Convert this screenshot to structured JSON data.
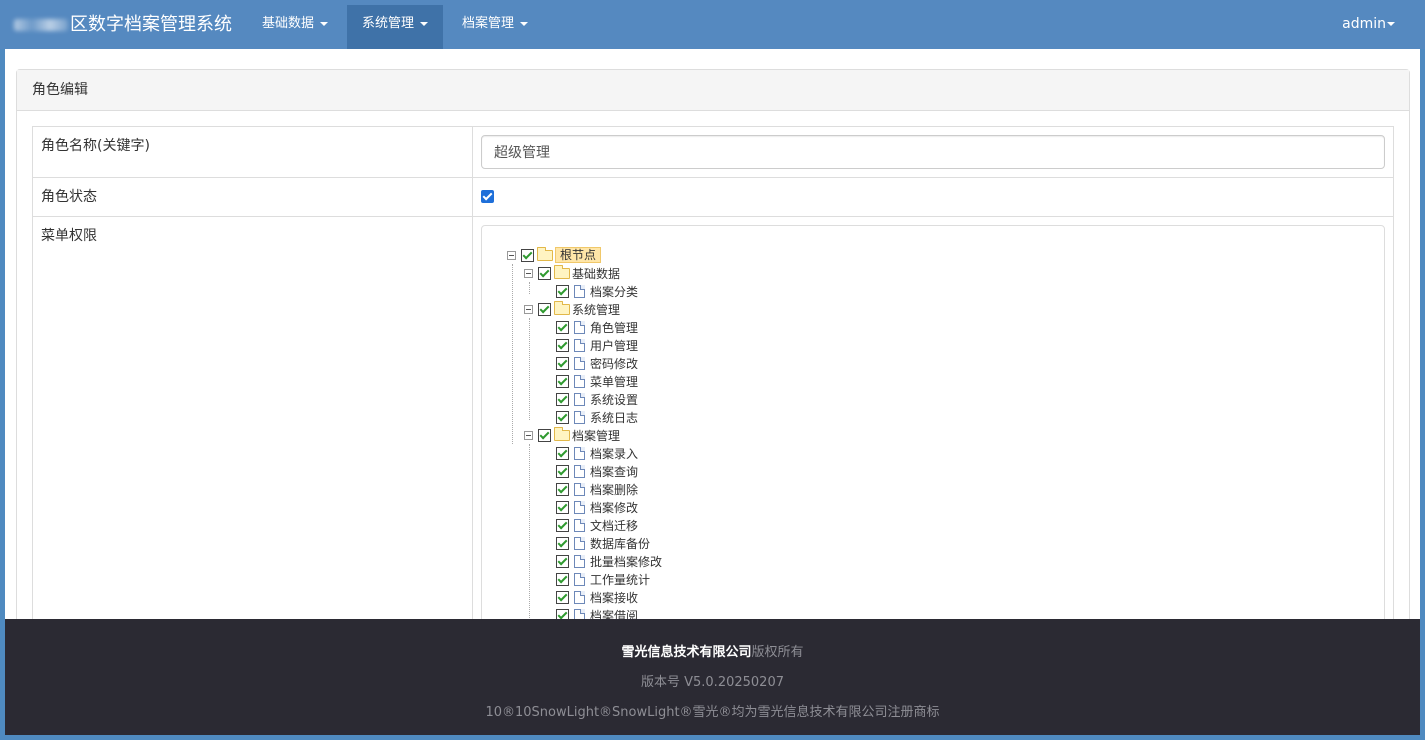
{
  "app": {
    "title": "区数字档案管理系统"
  },
  "nav": {
    "items": [
      {
        "label": "基础数据"
      },
      {
        "label": "系统管理"
      },
      {
        "label": "档案管理"
      }
    ],
    "user": "admin"
  },
  "panel": {
    "heading": "角色编辑"
  },
  "form": {
    "role_name_label": "角色名称(关键字)",
    "role_name_value": "超级管理",
    "role_status_label": "角色状态",
    "role_status_checked": true,
    "menu_perm_label": "菜单权限"
  },
  "tree": {
    "root": "根节点",
    "groups": [
      {
        "label": "基础数据",
        "children": [
          "档案分类"
        ]
      },
      {
        "label": "系统管理",
        "children": [
          "角色管理",
          "用户管理",
          "密码修改",
          "菜单管理",
          "系统设置",
          "系统日志"
        ]
      },
      {
        "label": "档案管理",
        "children": [
          "档案录入",
          "档案查询",
          "档案删除",
          "档案修改",
          "文档迁移",
          "数据库备份",
          "批量档案修改",
          "工作量统计",
          "档案接收",
          "档案借阅"
        ]
      }
    ]
  },
  "footer": {
    "company": "雪光信息技术有限公司",
    "rights": "版权所有",
    "version": "版本号 V5.0.20250207",
    "trademark": "10®10SnowLight®SnowLight®雪光®均为雪光信息技术有限公司注册商标"
  },
  "colors": {
    "navbar": "#5589c0",
    "nav_active": "#3f72a8",
    "footer": "#2b2a33"
  }
}
